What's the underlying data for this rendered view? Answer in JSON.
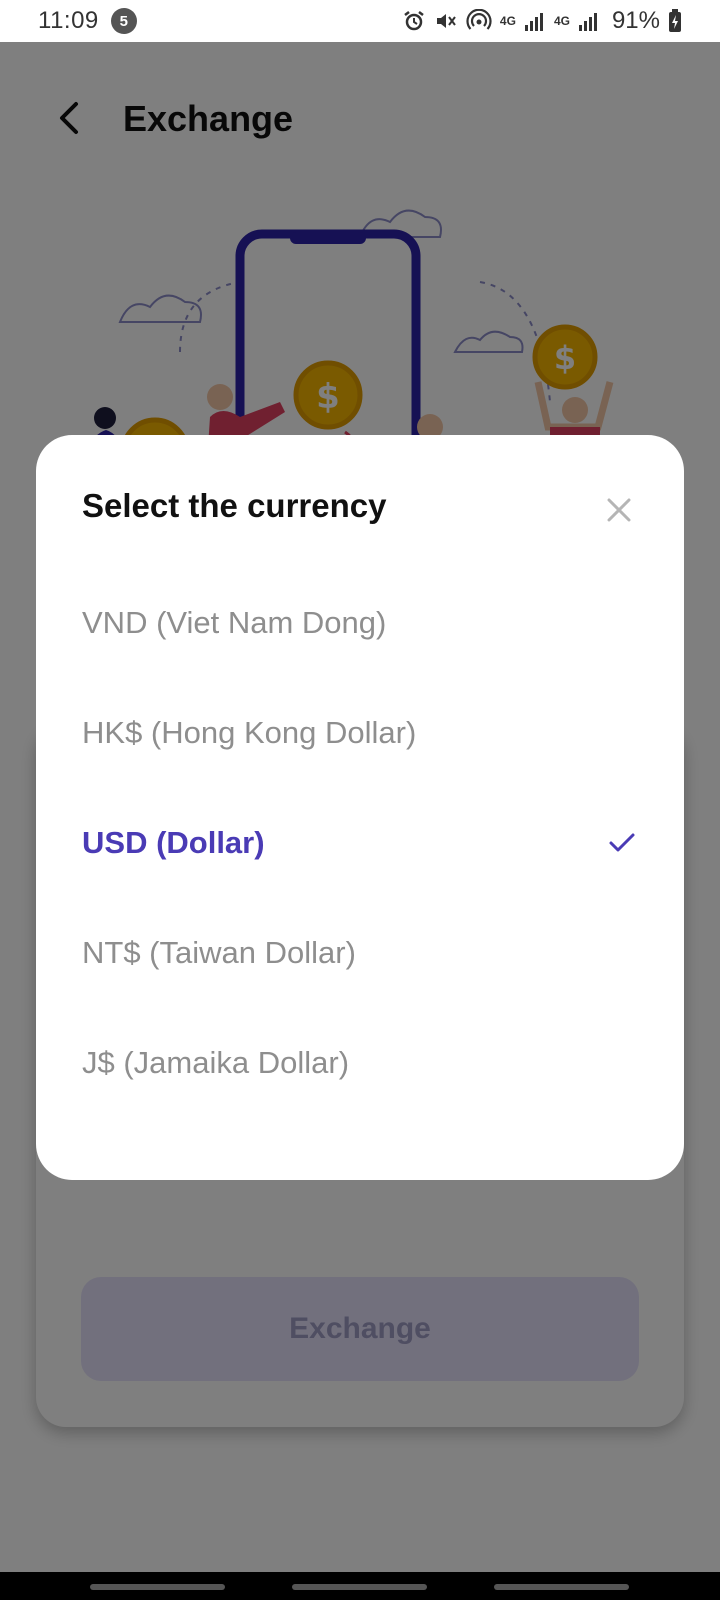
{
  "status_bar": {
    "time": "11:09",
    "notification_count": "5",
    "network_1": "4G",
    "network_2": "4G",
    "battery": "91%"
  },
  "header": {
    "title": "Exchange",
    "back_icon": "chevron-left-icon"
  },
  "card": {
    "exchange_button_label": "Exchange"
  },
  "modal": {
    "title": "Select the currency",
    "close_icon": "close-icon",
    "options": [
      {
        "label": "VND (Viet Nam Dong)",
        "selected": false
      },
      {
        "label": "HK$ (Hong Kong Dollar)",
        "selected": false
      },
      {
        "label": "USD (Dollar)",
        "selected": true
      },
      {
        "label": "NT$ (Taiwan Dollar)",
        "selected": false
      },
      {
        "label": "J$ (Jamaika Dollar)",
        "selected": false
      }
    ],
    "selected_icon": "checkmark-icon"
  },
  "colors": {
    "accent": "#4a3bb5",
    "unselected_text": "#8e8e8e",
    "scrim": "rgba(0,0,0,0.5)"
  }
}
